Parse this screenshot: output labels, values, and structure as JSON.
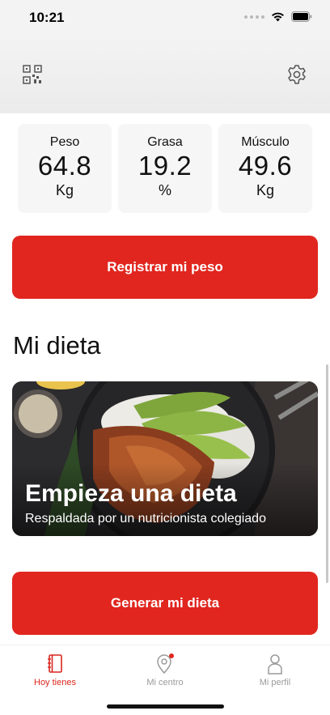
{
  "status_bar": {
    "time": "10:21"
  },
  "header": {
    "qr_icon": "qr-code-icon",
    "settings_icon": "gear-icon"
  },
  "stats": [
    {
      "label": "Peso",
      "value": "64.8",
      "unit": "Kg"
    },
    {
      "label": "Grasa",
      "value": "19.2",
      "unit": "%"
    },
    {
      "label": "Músculo",
      "value": "49.6",
      "unit": "Kg"
    }
  ],
  "register_button": {
    "label": "Registrar mi peso"
  },
  "diet": {
    "section_title": "Mi dieta",
    "card_title": "Empieza una dieta",
    "card_subtitle": "Respaldada por un nutricionista colegiado"
  },
  "generate_button": {
    "label": "Generar mi dieta"
  },
  "tabs": [
    {
      "label": "Hoy tienes",
      "icon": "notebook-icon",
      "active": true
    },
    {
      "label": "Mi centro",
      "icon": "location-pin-icon",
      "badge": true
    },
    {
      "label": "Mi perfil",
      "icon": "person-icon"
    }
  ],
  "colors": {
    "accent": "#e0261f",
    "background": "#ffffff",
    "card": "#f6f6f6"
  }
}
